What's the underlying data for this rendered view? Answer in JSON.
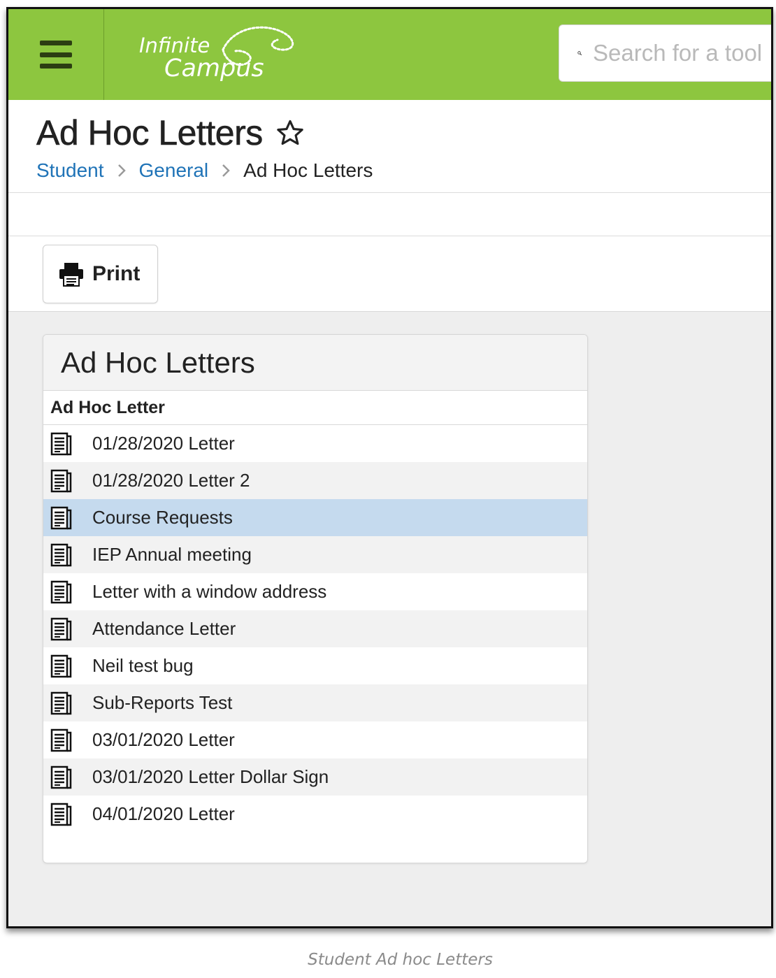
{
  "topbar": {
    "logo_text_line1": "Infinite",
    "logo_text_line2": "Campus",
    "search_placeholder": "Search for a tool",
    "brand_color": "#8dc63f"
  },
  "header": {
    "title": "Ad Hoc Letters",
    "breadcrumb": [
      {
        "label": "Student"
      },
      {
        "label": "General"
      },
      {
        "label": "Ad Hoc Letters"
      }
    ]
  },
  "toolbar": {
    "print_label": "Print"
  },
  "panel": {
    "title": "Ad Hoc Letters",
    "column_header": "Ad Hoc Letter",
    "selected_row": 2,
    "selected_color": "#c5daee",
    "rows": [
      "01/28/2020 Letter",
      "01/28/2020 Letter 2",
      "Course Requests",
      "IEP Annual meeting",
      "Letter with a window address",
      "Attendance Letter",
      "Neil test bug",
      "Sub-Reports Test",
      "03/01/2020 Letter",
      "03/01/2020 Letter Dollar Sign",
      "04/01/2020 Letter"
    ]
  },
  "caption": "Student Ad hoc Letters",
  "icons": {
    "menu": "hamburger-menu-icon",
    "search": "search-icon",
    "favorite": "star-outline-icon",
    "print": "printer-icon",
    "document": "document-icon"
  }
}
